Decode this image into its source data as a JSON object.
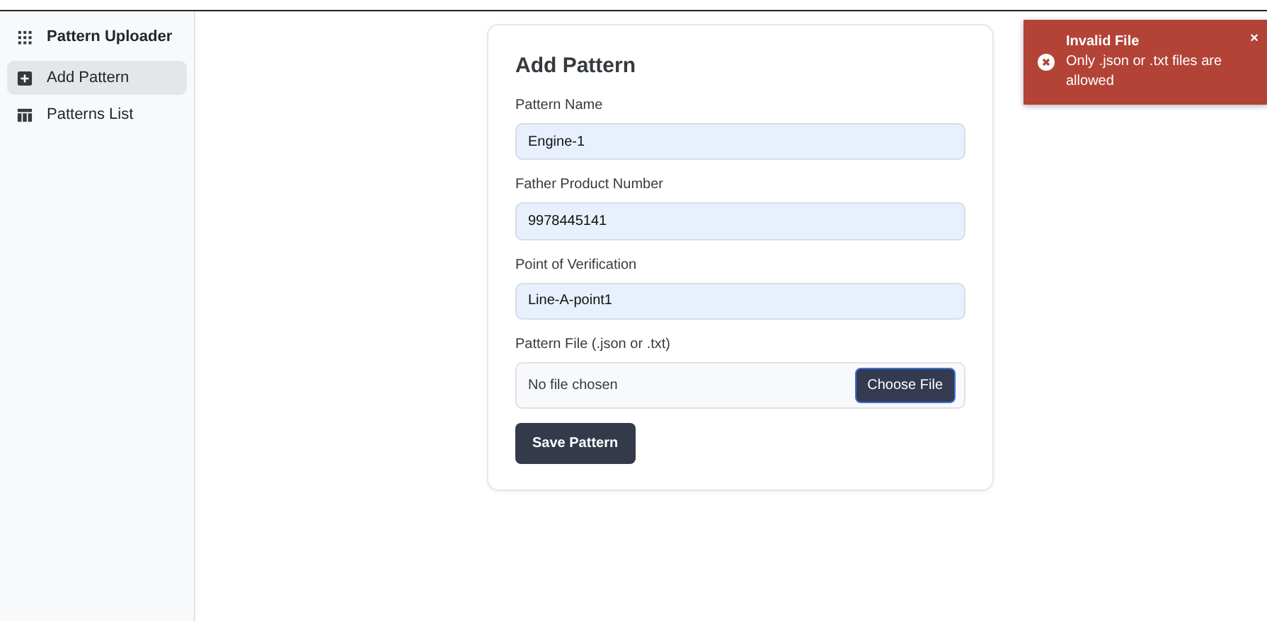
{
  "sidebar": {
    "title": "Pattern Uploader",
    "items": [
      {
        "label": "Add Pattern",
        "selected": true
      },
      {
        "label": "Patterns List",
        "selected": false
      }
    ]
  },
  "form": {
    "title": "Add Pattern",
    "fields": [
      {
        "kind": "text",
        "label": "Pattern Name",
        "value": "Engine-1"
      },
      {
        "kind": "text",
        "label": "Father Product Number",
        "value": "9978445141"
      },
      {
        "kind": "text",
        "label": "Point of Verification",
        "value": "Line-A-point1"
      },
      {
        "kind": "file",
        "label": "Pattern File (.json or .txt)",
        "value": "No file chosen",
        "button": "Choose File"
      }
    ],
    "submit": "Save Pattern"
  },
  "toast": {
    "title": "Invalid File",
    "message": "Only .json or .txt files are allowed",
    "close": "×"
  }
}
